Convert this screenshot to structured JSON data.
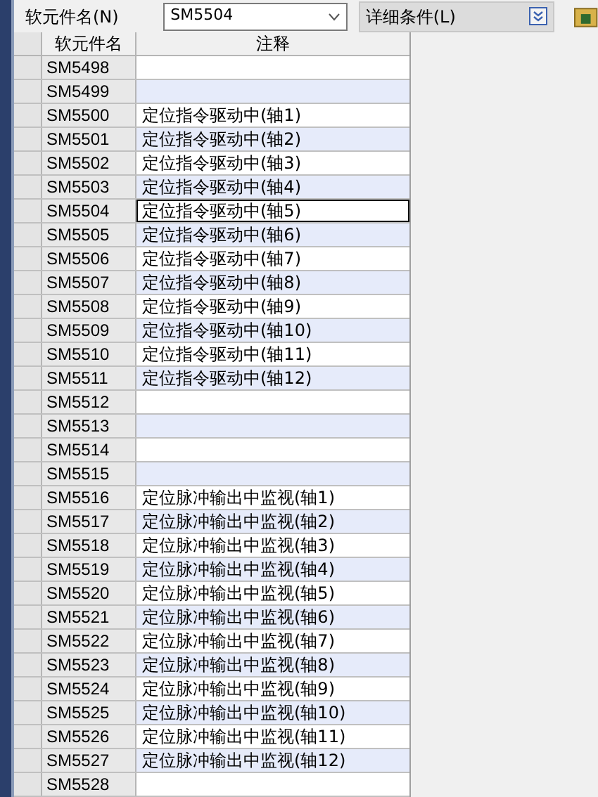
{
  "toolbar": {
    "device_label": "软元件名(N)",
    "device_value": "SM5504",
    "detail_label": "详细条件(L)"
  },
  "table": {
    "columns": [
      "软元件名",
      "注释"
    ],
    "rows": [
      {
        "device": "SM5498",
        "comment": "",
        "selected": false
      },
      {
        "device": "SM5499",
        "comment": "",
        "selected": false
      },
      {
        "device": "SM5500",
        "comment": "定位指令驱动中(轴1)",
        "selected": false
      },
      {
        "device": "SM5501",
        "comment": "定位指令驱动中(轴2)",
        "selected": false
      },
      {
        "device": "SM5502",
        "comment": "定位指令驱动中(轴3)",
        "selected": false
      },
      {
        "device": "SM5503",
        "comment": "定位指令驱动中(轴4)",
        "selected": false
      },
      {
        "device": "SM5504",
        "comment": "定位指令驱动中(轴5)",
        "selected": true
      },
      {
        "device": "SM5505",
        "comment": "定位指令驱动中(轴6)",
        "selected": false
      },
      {
        "device": "SM5506",
        "comment": "定位指令驱动中(轴7)",
        "selected": false
      },
      {
        "device": "SM5507",
        "comment": "定位指令驱动中(轴8)",
        "selected": false
      },
      {
        "device": "SM5508",
        "comment": "定位指令驱动中(轴9)",
        "selected": false
      },
      {
        "device": "SM5509",
        "comment": "定位指令驱动中(轴10)",
        "selected": false
      },
      {
        "device": "SM5510",
        "comment": "定位指令驱动中(轴11)",
        "selected": false
      },
      {
        "device": "SM5511",
        "comment": "定位指令驱动中(轴12)",
        "selected": false
      },
      {
        "device": "SM5512",
        "comment": "",
        "selected": false
      },
      {
        "device": "SM5513",
        "comment": "",
        "selected": false
      },
      {
        "device": "SM5514",
        "comment": "",
        "selected": false
      },
      {
        "device": "SM5515",
        "comment": "",
        "selected": false
      },
      {
        "device": "SM5516",
        "comment": "定位脉冲输出中监视(轴1)",
        "selected": false
      },
      {
        "device": "SM5517",
        "comment": "定位脉冲输出中监视(轴2)",
        "selected": false
      },
      {
        "device": "SM5518",
        "comment": "定位脉冲输出中监视(轴3)",
        "selected": false
      },
      {
        "device": "SM5519",
        "comment": "定位脉冲输出中监视(轴4)",
        "selected": false
      },
      {
        "device": "SM5520",
        "comment": "定位脉冲输出中监视(轴5)",
        "selected": false
      },
      {
        "device": "SM5521",
        "comment": "定位脉冲输出中监视(轴6)",
        "selected": false
      },
      {
        "device": "SM5522",
        "comment": "定位脉冲输出中监视(轴7)",
        "selected": false
      },
      {
        "device": "SM5523",
        "comment": "定位脉冲输出中监视(轴8)",
        "selected": false
      },
      {
        "device": "SM5524",
        "comment": "定位脉冲输出中监视(轴9)",
        "selected": false
      },
      {
        "device": "SM5525",
        "comment": "定位脉冲输出中监视(轴10)",
        "selected": false
      },
      {
        "device": "SM5526",
        "comment": "定位脉冲输出中监视(轴11)",
        "selected": false
      },
      {
        "device": "SM5527",
        "comment": "定位脉冲输出中监视(轴12)",
        "selected": false
      },
      {
        "device": "SM5528",
        "comment": "",
        "selected": false
      }
    ]
  }
}
